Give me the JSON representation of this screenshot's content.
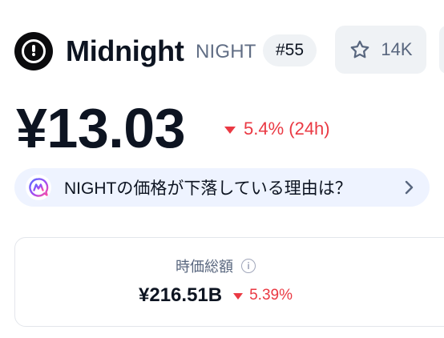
{
  "coin": {
    "name": "Midnight",
    "symbol": "NIGHT",
    "rank": "#55",
    "logo_icon": "midnight-logo-icon"
  },
  "watchlist": {
    "icon": "star-icon",
    "count": "14K"
  },
  "price": {
    "value": "¥13.03",
    "change": "5.4% (24h)",
    "direction": "down",
    "color": "#ea3943"
  },
  "ai_banner": {
    "question": "NIGHTの価格が下落している理由は？",
    "icon": "ai-assistant-icon",
    "chevron": "chevron-right-icon"
  },
  "market_cap": {
    "label": "時価総額",
    "value": "¥216.51B",
    "change": "5.39%",
    "direction": "down"
  },
  "colors": {
    "text_primary": "#0d1421",
    "text_secondary": "#58667e",
    "negative": "#ea3943",
    "chip_bg": "#eff2f5",
    "banner_bg": "#eef3ff"
  }
}
